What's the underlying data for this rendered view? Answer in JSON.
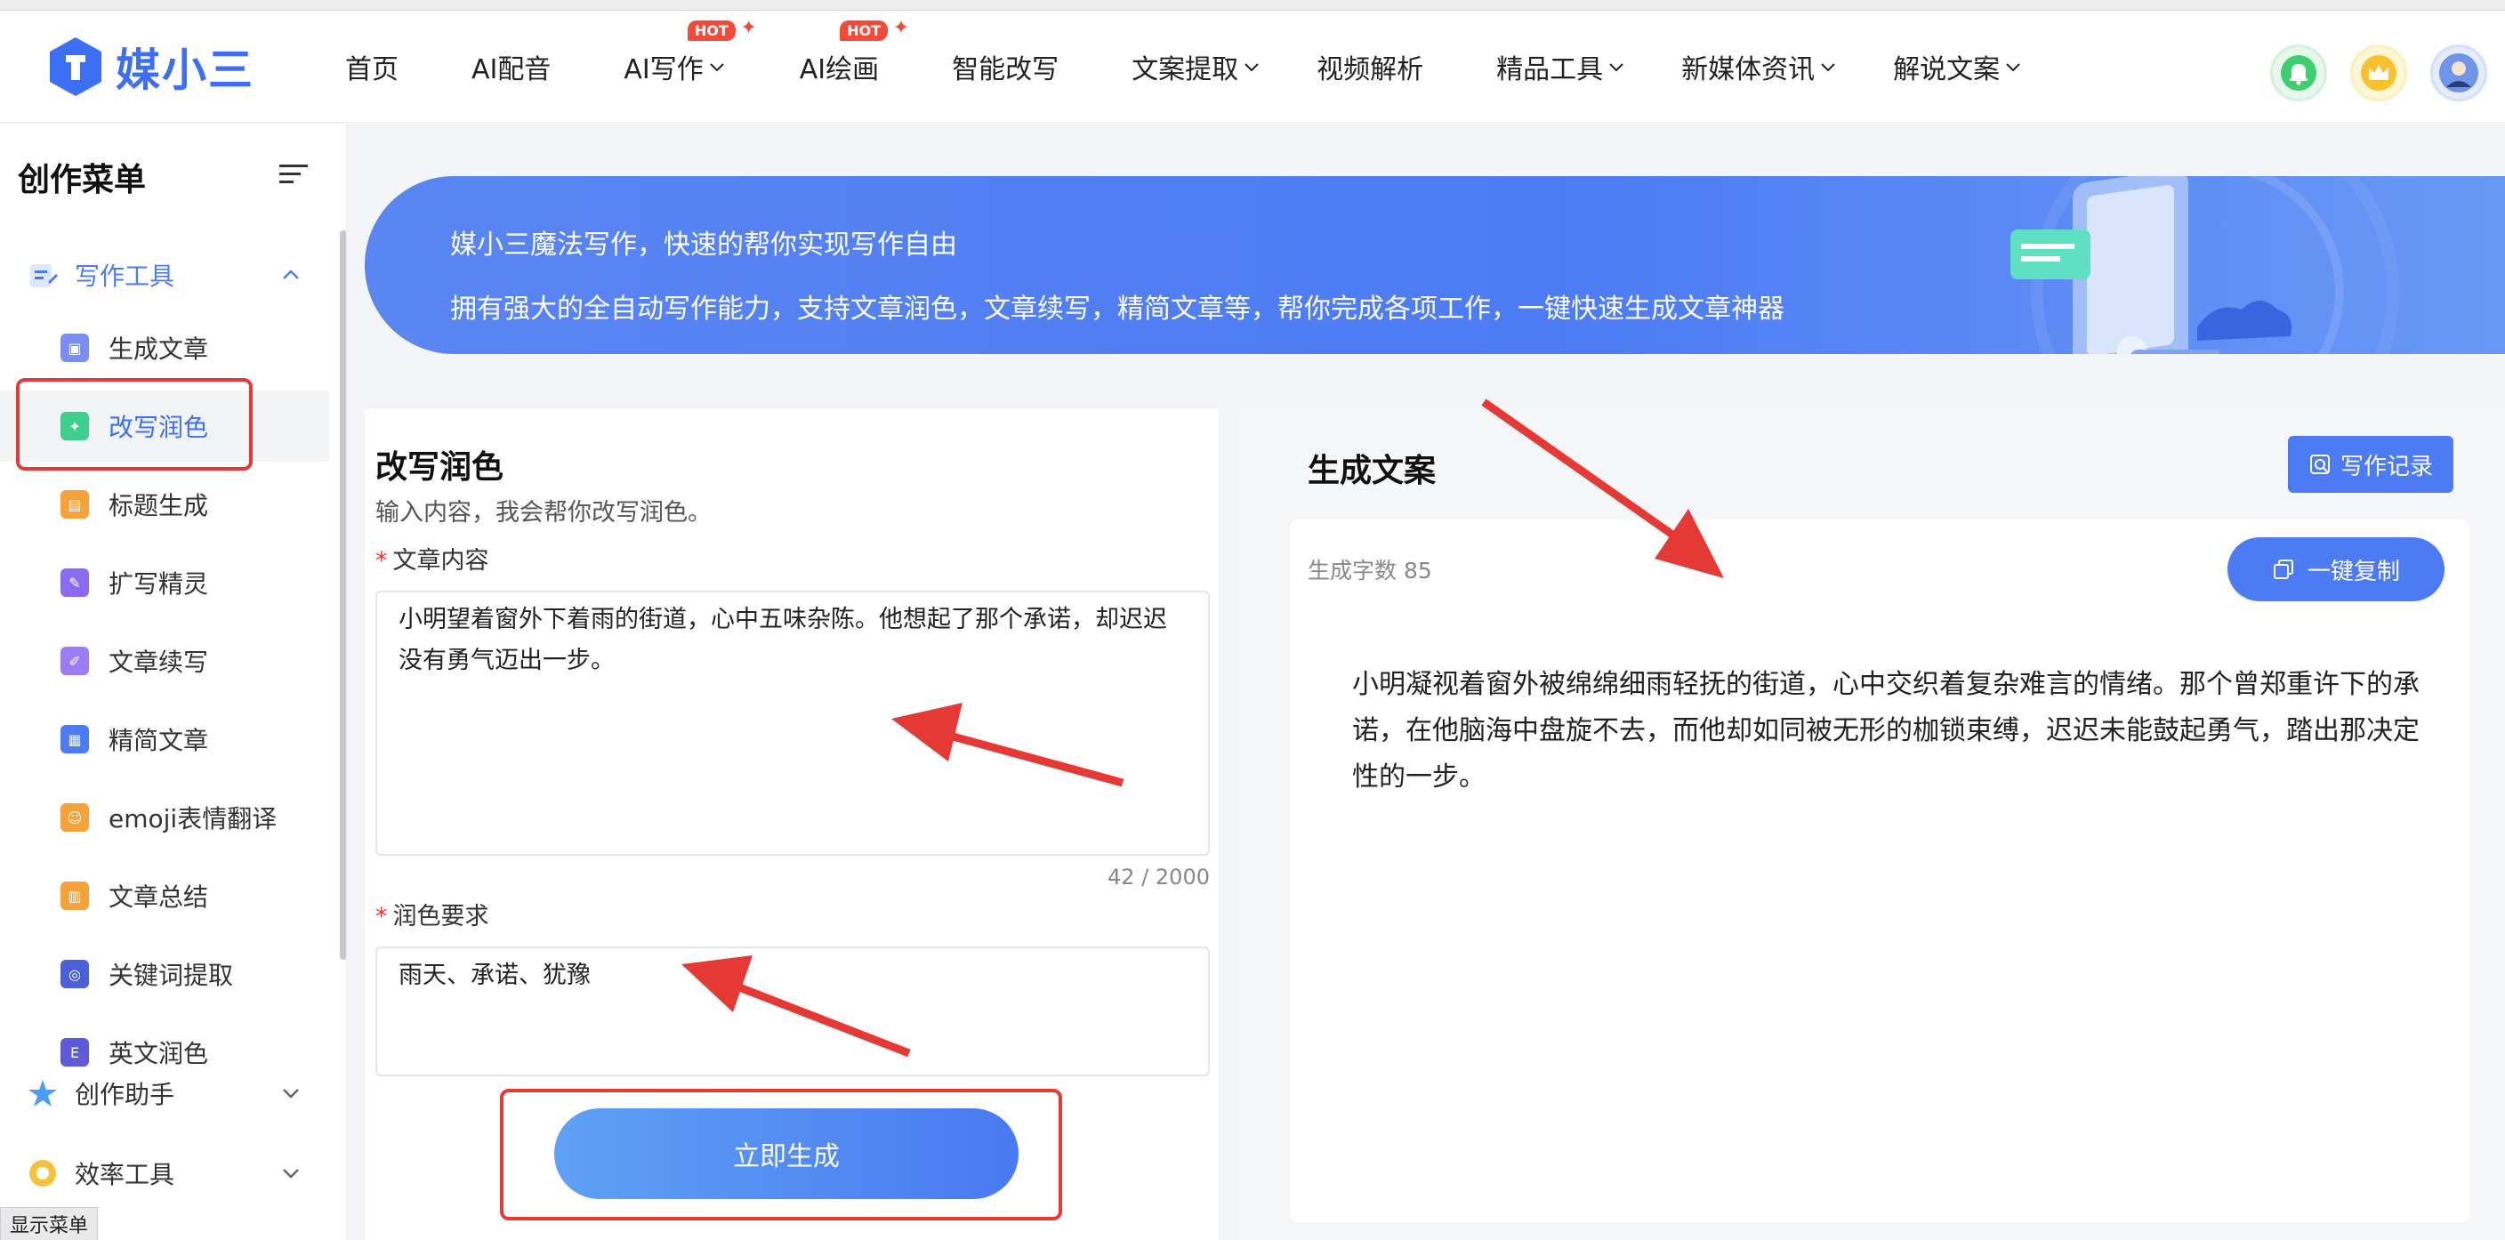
{
  "brand": {
    "name": "媒小三",
    "color": "#3d6ff5"
  },
  "nav": {
    "items": [
      {
        "label": "首页",
        "dropdown": false,
        "hot": false
      },
      {
        "label": "AI配音",
        "dropdown": false,
        "hot": false
      },
      {
        "label": "AI写作",
        "dropdown": true,
        "hot": true
      },
      {
        "label": "AI绘画",
        "dropdown": false,
        "hot": true
      },
      {
        "label": "智能改写",
        "dropdown": false,
        "hot": false
      },
      {
        "label": "文案提取",
        "dropdown": true,
        "hot": false
      },
      {
        "label": "视频解析",
        "dropdown": false,
        "hot": false
      },
      {
        "label": "精品工具",
        "dropdown": true,
        "hot": false
      },
      {
        "label": "新媒体资讯",
        "dropdown": true,
        "hot": false
      },
      {
        "label": "解说文案",
        "dropdown": true,
        "hot": false
      }
    ],
    "hot_label": "HOT"
  },
  "header_icons": [
    "bell-icon",
    "crown-icon",
    "avatar"
  ],
  "sidebar": {
    "title": "创作菜单",
    "group_writing": {
      "label": "写作工具",
      "expanded": true
    },
    "items": [
      {
        "label": "生成文章",
        "color": "#7b8df0",
        "icon": "scan-icon"
      },
      {
        "label": "改写润色",
        "color": "#3ecf8e",
        "icon": "sparkle-icon"
      },
      {
        "label": "标题生成",
        "color": "#f5a23a",
        "icon": "doc-icon"
      },
      {
        "label": "扩写精灵",
        "color": "#8b6cf0",
        "icon": "expand-icon"
      },
      {
        "label": "文章续写",
        "color": "#9b7cf5",
        "icon": "pen-icon"
      },
      {
        "label": "精简文章",
        "color": "#4c7bf3",
        "icon": "grid-icon"
      },
      {
        "label": "emoji表情翻译",
        "color": "#f5a23a",
        "icon": "emoji-icon"
      },
      {
        "label": "文章总结",
        "color": "#f5a23a",
        "icon": "summary-icon"
      },
      {
        "label": "关键词提取",
        "color": "#4c5fd8",
        "icon": "target-icon"
      },
      {
        "label": "英文润色",
        "color": "#5e5ad8",
        "icon": "english-icon"
      }
    ],
    "active_index": 1,
    "group_assistant": {
      "label": "创作助手"
    },
    "group_efficiency": {
      "label": "效率工具"
    },
    "show_menu": "显示菜单"
  },
  "banner": {
    "line1": "媒小三魔法写作，快速的帮你实现写作自由",
    "line2": "拥有强大的全自动写作能力，支持文章润色，文章续写，精简文章等，帮你完成各项工作，一键快速生成文章神器"
  },
  "form": {
    "title": "改写润色",
    "subtitle": "输入内容，我会帮你改写润色。",
    "content_label": "文章内容",
    "content_value": "小明望着窗外下着雨的街道，心中五味杂陈。他想起了那个承诺，却迟迟没有勇气迈出一步。",
    "counter": "42 / 2000",
    "require_label": "润色要求",
    "require_value": "雨天、承诺、犹豫",
    "generate_label": "立即生成"
  },
  "output": {
    "title": "生成文案",
    "record_label": "写作记录",
    "count_label": "生成字数 85",
    "copy_label": "一键复制",
    "text": "小明凝视着窗外被绵绵细雨轻抚的街道，心中交织着复杂难言的情绪。那个曾郑重许下的承诺，在他脑海中盘旋不去，而他却如同被无形的枷锁束缚，迟迟未能鼓起勇气，踏出那决定性的一步。"
  },
  "colors": {
    "accent": "#4c7bf3",
    "annotation": "#e53935"
  }
}
